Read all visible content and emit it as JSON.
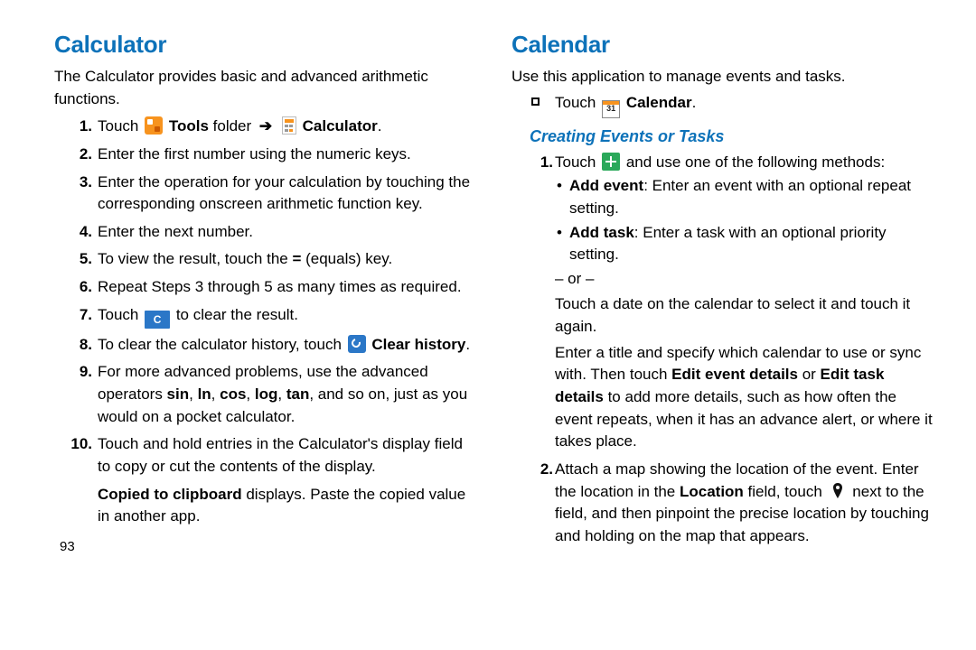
{
  "left": {
    "heading": "Calculator",
    "intro": "The Calculator provides basic and advanced arithmetic functions.",
    "step1_a": "Touch ",
    "step1_tools": "Tools",
    "step1_b": " folder ",
    "step1_calc": "Calculator",
    "step1_end": ".",
    "step2": "Enter the first number using the numeric keys.",
    "step3": "Enter the operation for your calculation by touching the corresponding onscreen arithmetic function key.",
    "step4": "Enter the next number.",
    "step5_a": "To view the result, touch the ",
    "step5_eq": "=",
    "step5_b": " (equals) key.",
    "step6": "Repeat Steps 3 through 5 as many times as required.",
    "step7_a": "Touch ",
    "step7_b": " to clear the result.",
    "step7_c_label": "C",
    "step8_a": "To clear the calculator history, touch ",
    "step8_b": "Clear history",
    "step8_end": ".",
    "step9_a": "For more advanced problems, use the advanced operators ",
    "step9_ops": [
      "sin",
      "ln",
      "cos",
      "log",
      "tan"
    ],
    "step9_b": ", and so on, just as you would on a pocket calculator.",
    "step10_a": "Touch and hold entries in the Calculator's display field to copy or cut the contents of the display.",
    "step10_b1": "Copied to clipboard",
    "step10_b2": " displays. Paste the copied value in another app.",
    "page_number": "93"
  },
  "right": {
    "heading": "Calendar",
    "intro": "Use this application to manage events and tasks.",
    "bullet_a": "Touch ",
    "bullet_cal_label": "31",
    "bullet_b": "Calendar",
    "bullet_end": ".",
    "sub_heading": "Creating Events or Tasks",
    "s1_a": "Touch ",
    "s1_b": " and use one of the following methods:",
    "s1_add_event_k": "Add event",
    "s1_add_event_v": ": Enter an event with an optional repeat setting.",
    "s1_add_task_k": "Add task",
    "s1_add_task_v": ": Enter a task with an optional priority setting.",
    "s1_or": "– or –",
    "s1_p1": "Touch a date on the calendar to select it and touch it again.",
    "s1_p2_a": "Enter a title and specify which calendar to use or sync with. Then touch ",
    "s1_p2_b": "Edit event details",
    "s1_p2_c": " or ",
    "s1_p2_d": "Edit task details",
    "s1_p2_e": " to add more details, such as how often the event repeats, when it has an advance alert, or where it takes place.",
    "s2_a": "Attach a map showing the location of the event. Enter the location in the ",
    "s2_loc": "Location",
    "s2_b": " field, touch ",
    "s2_c": " next to the field, and then pinpoint the precise location by touching and holding on the map that appears."
  },
  "arrow": "➔"
}
